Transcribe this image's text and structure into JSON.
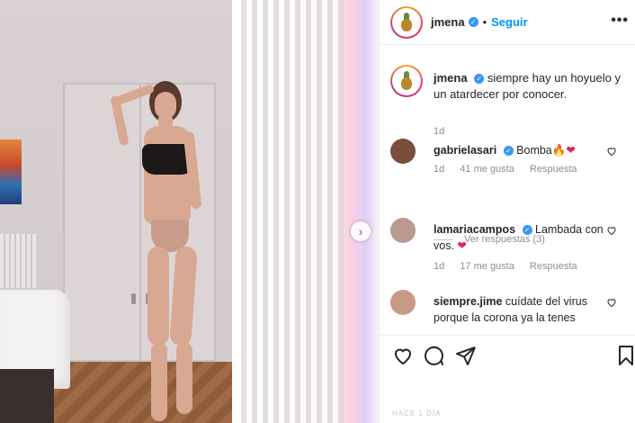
{
  "post": {
    "username": "jmena",
    "dot": "•",
    "follow_label": "Seguir",
    "more_label": "•••"
  },
  "caption": {
    "username": "jmena",
    "text": "siempre hay un hoyuelo y un atardecer por conocer.",
    "time": "1d"
  },
  "comments": [
    {
      "username": "gabrielasari",
      "verified": true,
      "text": "Bomba",
      "emojis": [
        "fire",
        "red-heart"
      ],
      "fire": "🔥",
      "heart": "❤",
      "time": "1d",
      "likes": "41 me gusta",
      "reply_label": "Respuesta",
      "avatar_color": "#7a4d3c"
    },
    {
      "username": "lamariacampos",
      "verified": true,
      "text": "Lambada con vos.",
      "emojis": [
        "red-heart"
      ],
      "heart": "❤",
      "time": "1d",
      "likes": "17 me gusta",
      "reply_label": "Respuesta",
      "avatar_color": "#b89b8e"
    },
    {
      "username": "siempre.jime",
      "verified": false,
      "text": "cuídate del virus porque la corona ya la tenes",
      "avatar_color": "#c79a86"
    }
  ],
  "view_replies_label": "Ver respuestas (3)",
  "footer_peek": "HACE 1 DÍA",
  "icons": [
    "heart-icon",
    "comment-icon",
    "share-icon",
    "bookmark-icon",
    "next-arrow-icon",
    "more-icon",
    "verified-icon"
  ],
  "colors": {
    "link": "#0095f6",
    "verified": "#3897f0",
    "muted": "#8e8e8e",
    "text": "#262626"
  }
}
